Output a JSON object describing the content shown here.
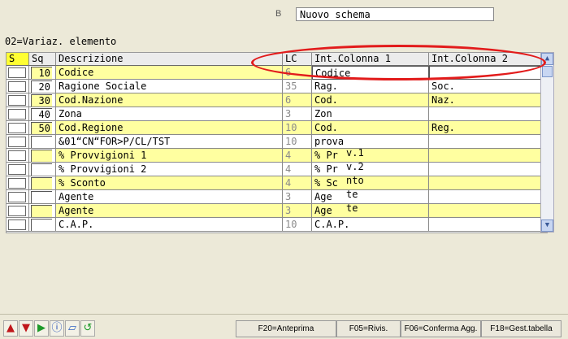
{
  "header": {
    "b_label": "B",
    "schema_name": "Nuovo schema"
  },
  "mode_label": "02=Variaz. elemento",
  "columns": {
    "s": "S",
    "sq": "Sq",
    "descrizione": "Descrizione",
    "lc": "LC",
    "col1": "Int.Colonna 1",
    "col2": "Int.Colonna 2"
  },
  "rows": [
    {
      "sq": "10",
      "descr": "Codice",
      "lc": "6",
      "c1": "Codice",
      "c2": "",
      "suf": ""
    },
    {
      "sq": "20",
      "descr": "Ragione Sociale",
      "lc": "35",
      "c1": "Rag.",
      "c2": "Soc.",
      "suf": ""
    },
    {
      "sq": "30",
      "descr": "Cod.Nazione",
      "lc": "6",
      "c1": "Cod.",
      "c2": "Naz.",
      "suf": ""
    },
    {
      "sq": "40",
      "descr": "Zona",
      "lc": "3",
      "c1": "Zon",
      "c2": "",
      "suf": ""
    },
    {
      "sq": "50",
      "descr": "Cod.Regione",
      "lc": "10",
      "c1": "Cod.",
      "c2": "Reg.",
      "suf": ""
    },
    {
      "sq": "",
      "descr": "&01“CN“FOR>P/CL/TST",
      "lc": "10",
      "c1": "prova",
      "c2": "",
      "suf": ""
    },
    {
      "sq": "",
      "descr": "% Provvigioni 1",
      "lc": "4",
      "c1": "% Pr",
      "c2": "",
      "suf": "v.1"
    },
    {
      "sq": "",
      "descr": "% Provvigioni 2",
      "lc": "4",
      "c1": "% Pr",
      "c2": "",
      "suf": "v.2"
    },
    {
      "sq": "",
      "descr": "% Sconto",
      "lc": "4",
      "c1": "% Sc",
      "c2": "",
      "suf": "nto"
    },
    {
      "sq": "",
      "descr": "Agente",
      "lc": "3",
      "c1": "Age",
      "c2": "",
      "suf": "te"
    },
    {
      "sq": "",
      "descr": "Agente",
      "lc": "3",
      "c1": "Age",
      "c2": "",
      "suf": "te"
    },
    {
      "sq": "",
      "descr": "C.A.P.",
      "lc": "10",
      "c1": "C.A.P.",
      "c2": "",
      "suf": ""
    }
  ],
  "nav_icons": [
    "arrow-up-icon",
    "arrow-down-icon",
    "play-icon",
    "info-icon",
    "eraser-icon",
    "refresh-icon"
  ],
  "function_keys": [
    "F20=Anteprima",
    "F05=Rivis.",
    "F06=Conferma Agg.",
    "F18=Gest.tabella"
  ],
  "colors": {
    "yellow_row": "#ffffa0",
    "s_header": "#ffff33",
    "highlight_ellipse": "#e21b1b"
  }
}
